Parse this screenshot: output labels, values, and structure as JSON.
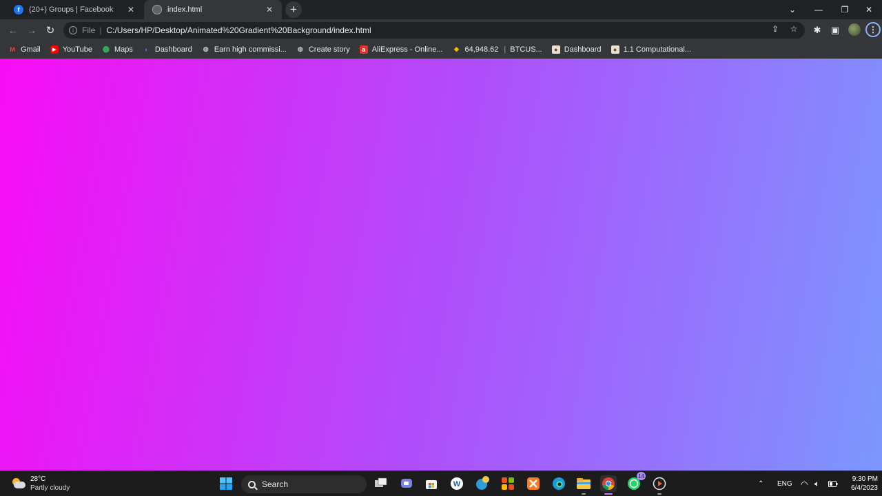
{
  "tabs": [
    {
      "title": "(20+) Groups | Facebook",
      "active": false,
      "favicon": "facebook-icon"
    },
    {
      "title": "index.html",
      "active": true,
      "favicon": "globe-icon"
    }
  ],
  "omnibox": {
    "scheme": "File",
    "url": "C:/Users/HP/Desktop/Animated%20Gradient%20Background/index.html"
  },
  "bookmarks": [
    {
      "label": "Gmail",
      "icon": "gmail-icon"
    },
    {
      "label": "YouTube",
      "icon": "youtube-icon"
    },
    {
      "label": "Maps",
      "icon": "maps-icon"
    },
    {
      "label": "Dashboard",
      "icon": "dashboard-icon"
    },
    {
      "label": "Earn high commissi...",
      "icon": "globe-icon"
    },
    {
      "label": "Create story",
      "icon": "globe-icon"
    },
    {
      "label": "AliExpress - Online...",
      "icon": "aliexpress-icon"
    },
    {
      "label": "64,948.62",
      "extra": "BTCUS...",
      "icon": "binance-icon"
    },
    {
      "label": "Dashboard",
      "icon": "avatar-icon"
    },
    {
      "label": "1.1 Computational...",
      "icon": "avatar-icon"
    }
  ],
  "page": {
    "gradient_start": "#f80cf5",
    "gradient_mid": "#b04dfc",
    "gradient_end": "#7b97fe"
  },
  "taskbar": {
    "weather_temp": "28°C",
    "weather_condition": "Partly cloudy",
    "search_label": "Search",
    "whatsapp_badge": "14",
    "language": "ENG",
    "time": "9:30 PM",
    "date": "6/4/2023"
  }
}
